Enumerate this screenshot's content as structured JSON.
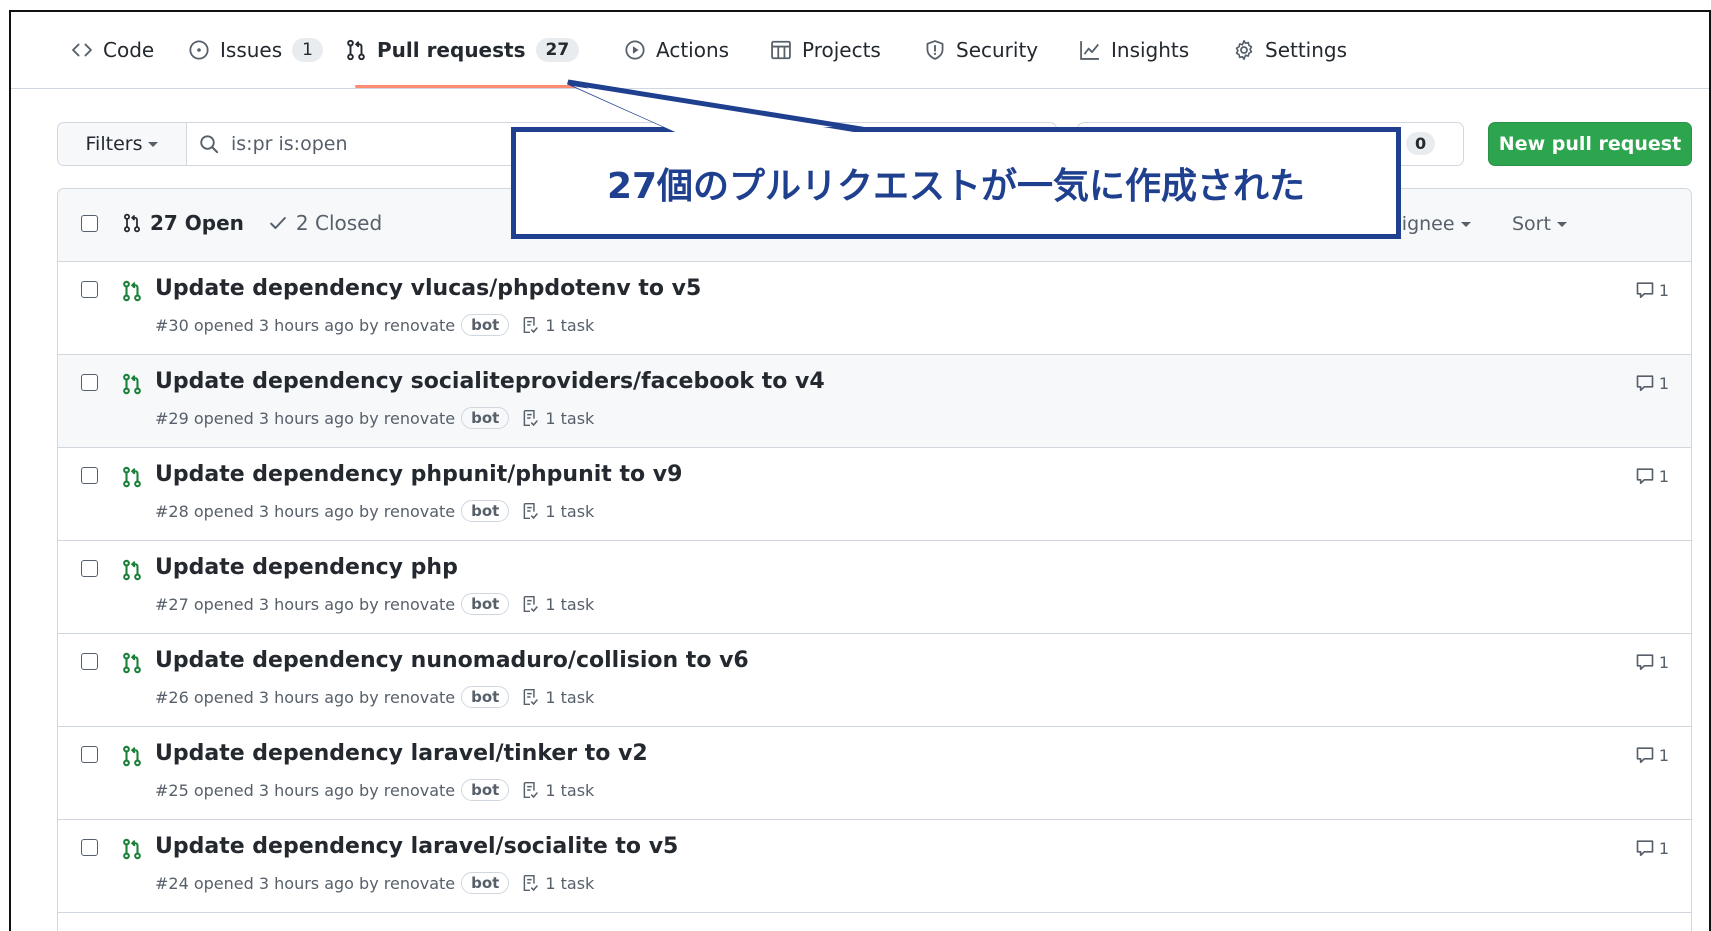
{
  "nav": {
    "tabs": [
      {
        "label": "Code",
        "icon": "code-icon"
      },
      {
        "label": "Issues",
        "icon": "issue-icon",
        "count": "1"
      },
      {
        "label": "Pull requests",
        "icon": "pull-request-icon",
        "count": "27",
        "selected": true
      },
      {
        "label": "Actions",
        "icon": "play-icon"
      },
      {
        "label": "Projects",
        "icon": "table-icon"
      },
      {
        "label": "Security",
        "icon": "shield-icon"
      },
      {
        "label": "Insights",
        "icon": "graph-icon"
      },
      {
        "label": "Settings",
        "icon": "gear-icon"
      }
    ]
  },
  "toolbar": {
    "filters_label": "Filters",
    "search_value": "is:pr is:open",
    "milestones_count": "0",
    "new_pr_label": "New pull request"
  },
  "list": {
    "open_label": "27 Open",
    "closed_label": "2 Closed",
    "assignee_label": "Assignee",
    "sort_label": "Sort",
    "rows": [
      {
        "title": "Update dependency vlucas/phpdotenv to v5",
        "meta": "#30 opened 3 hours ago by renovate",
        "bot": "bot",
        "task": "1 task",
        "comments": "1"
      },
      {
        "title": "Update dependency socialiteproviders/facebook to v4",
        "meta": "#29 opened 3 hours ago by renovate",
        "bot": "bot",
        "task": "1 task",
        "comments": "1"
      },
      {
        "title": "Update dependency phpunit/phpunit to v9",
        "meta": "#28 opened 3 hours ago by renovate",
        "bot": "bot",
        "task": "1 task",
        "comments": "1"
      },
      {
        "title": "Update dependency php",
        "meta": "#27 opened 3 hours ago by renovate",
        "bot": "bot",
        "task": "1 task",
        "comments": ""
      },
      {
        "title": "Update dependency nunomaduro/collision to v6",
        "meta": "#26 opened 3 hours ago by renovate",
        "bot": "bot",
        "task": "1 task",
        "comments": "1"
      },
      {
        "title": "Update dependency laravel/tinker to v2",
        "meta": "#25 opened 3 hours ago by renovate",
        "bot": "bot",
        "task": "1 task",
        "comments": "1"
      },
      {
        "title": "Update dependency laravel/socialite to v5",
        "meta": "#24 opened 3 hours ago by renovate",
        "bot": "bot",
        "task": "1 task",
        "comments": "1"
      }
    ]
  },
  "annotation": {
    "text": "27個のプルリクエストが一気に作成された",
    "color": "#1f3f8f"
  }
}
